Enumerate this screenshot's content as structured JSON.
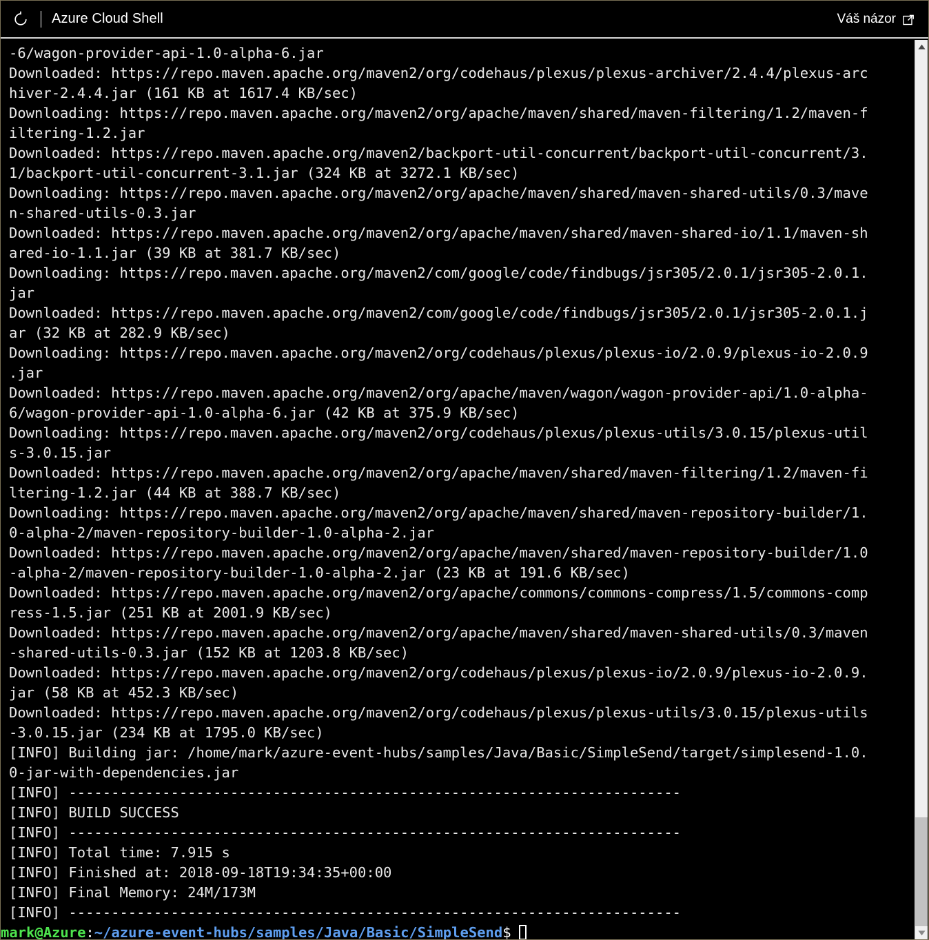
{
  "header": {
    "restart_icon": "restart-icon",
    "title": "Azure Cloud Shell",
    "feedback_label": "Váš názor",
    "feedback_icon": "external-link-icon"
  },
  "scrollbar": {
    "up_icon": "chevron-up-icon",
    "down_icon": "chevron-down-icon"
  },
  "terminal": {
    "text_color": "#e8e8e8",
    "background_color": "#000000",
    "lines": [
      "-6/wagon-provider-api-1.0-alpha-6.jar",
      "Downloaded: https://repo.maven.apache.org/maven2/org/codehaus/plexus/plexus-archiver/2.4.4/plexus-arc",
      "hiver-2.4.4.jar (161 KB at 1617.4 KB/sec)",
      "Downloading: https://repo.maven.apache.org/maven2/org/apache/maven/shared/maven-filtering/1.2/maven-f",
      "iltering-1.2.jar",
      "Downloaded: https://repo.maven.apache.org/maven2/backport-util-concurrent/backport-util-concurrent/3.",
      "1/backport-util-concurrent-3.1.jar (324 KB at 3272.1 KB/sec)",
      "Downloading: https://repo.maven.apache.org/maven2/org/apache/maven/shared/maven-shared-utils/0.3/mave",
      "n-shared-utils-0.3.jar",
      "Downloaded: https://repo.maven.apache.org/maven2/org/apache/maven/shared/maven-shared-io/1.1/maven-sh",
      "ared-io-1.1.jar (39 KB at 381.7 KB/sec)",
      "Downloading: https://repo.maven.apache.org/maven2/com/google/code/findbugs/jsr305/2.0.1/jsr305-2.0.1.",
      "jar",
      "Downloaded: https://repo.maven.apache.org/maven2/com/google/code/findbugs/jsr305/2.0.1/jsr305-2.0.1.j",
      "ar (32 KB at 282.9 KB/sec)",
      "Downloading: https://repo.maven.apache.org/maven2/org/codehaus/plexus/plexus-io/2.0.9/plexus-io-2.0.9",
      ".jar",
      "Downloaded: https://repo.maven.apache.org/maven2/org/apache/maven/wagon/wagon-provider-api/1.0-alpha-",
      "6/wagon-provider-api-1.0-alpha-6.jar (42 KB at 375.9 KB/sec)",
      "Downloading: https://repo.maven.apache.org/maven2/org/codehaus/plexus/plexus-utils/3.0.15/plexus-util",
      "s-3.0.15.jar",
      "Downloaded: https://repo.maven.apache.org/maven2/org/apache/maven/shared/maven-filtering/1.2/maven-fi",
      "ltering-1.2.jar (44 KB at 388.7 KB/sec)",
      "Downloading: https://repo.maven.apache.org/maven2/org/apache/maven/shared/maven-repository-builder/1.",
      "0-alpha-2/maven-repository-builder-1.0-alpha-2.jar",
      "Downloaded: https://repo.maven.apache.org/maven2/org/apache/maven/shared/maven-repository-builder/1.0",
      "-alpha-2/maven-repository-builder-1.0-alpha-2.jar (23 KB at 191.6 KB/sec)",
      "Downloaded: https://repo.maven.apache.org/maven2/org/apache/commons/commons-compress/1.5/commons-comp",
      "ress-1.5.jar (251 KB at 2001.9 KB/sec)",
      "Downloaded: https://repo.maven.apache.org/maven2/org/apache/maven/shared/maven-shared-utils/0.3/maven",
      "-shared-utils-0.3.jar (152 KB at 1203.8 KB/sec)",
      "Downloaded: https://repo.maven.apache.org/maven2/org/codehaus/plexus/plexus-io/2.0.9/plexus-io-2.0.9.",
      "jar (58 KB at 452.3 KB/sec)",
      "Downloaded: https://repo.maven.apache.org/maven2/org/codehaus/plexus/plexus-utils/3.0.15/plexus-utils",
      "-3.0.15.jar (234 KB at 1795.0 KB/sec)",
      "[INFO] Building jar: /home/mark/azure-event-hubs/samples/Java/Basic/SimpleSend/target/simplesend-1.0.",
      "0-jar-with-dependencies.jar",
      "[INFO] ------------------------------------------------------------------------",
      "[INFO] BUILD SUCCESS",
      "[INFO] ------------------------------------------------------------------------",
      "[INFO] Total time: 7.915 s",
      "[INFO] Finished at: 2018-09-18T19:34:35+00:00",
      "[INFO] Final Memory: 24M/173M",
      "[INFO] ------------------------------------------------------------------------"
    ],
    "prompt": {
      "user_host": "mark@Azure",
      "separator": ":",
      "path": "~/azure-event-hubs/samples/Java/Basic/SimpleSend",
      "symbol": "$",
      "user_color": "#4ee44e",
      "path_color": "#5f9ff0",
      "command": ""
    }
  }
}
